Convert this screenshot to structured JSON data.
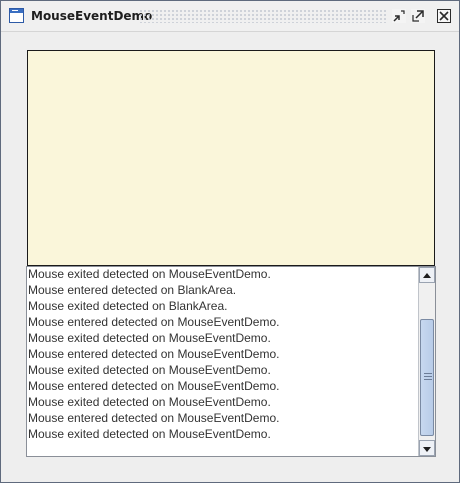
{
  "window": {
    "title": "MouseEventDemo"
  },
  "log": {
    "lines": [
      "Mouse exited detected on MouseEventDemo.",
      "Mouse entered detected on BlankArea.",
      "Mouse exited detected on BlankArea.",
      "Mouse entered detected on MouseEventDemo.",
      "Mouse exited detected on MouseEventDemo.",
      "Mouse entered detected on MouseEventDemo.",
      "Mouse exited detected on MouseEventDemo.",
      "Mouse entered detected on MouseEventDemo.",
      "Mouse exited detected on MouseEventDemo.",
      "Mouse entered detected on MouseEventDemo.",
      "Mouse exited detected on MouseEventDemo."
    ]
  },
  "icons": {
    "app": "window-icon",
    "iconify": "minimize-icon",
    "maximize": "maximize-icon",
    "close": "close-icon",
    "scroll_up": "arrow-up-icon",
    "scroll_down": "arrow-down-icon"
  },
  "colors": {
    "blank_area_fill": "#faf6da",
    "window_bg": "#eeeeee"
  }
}
